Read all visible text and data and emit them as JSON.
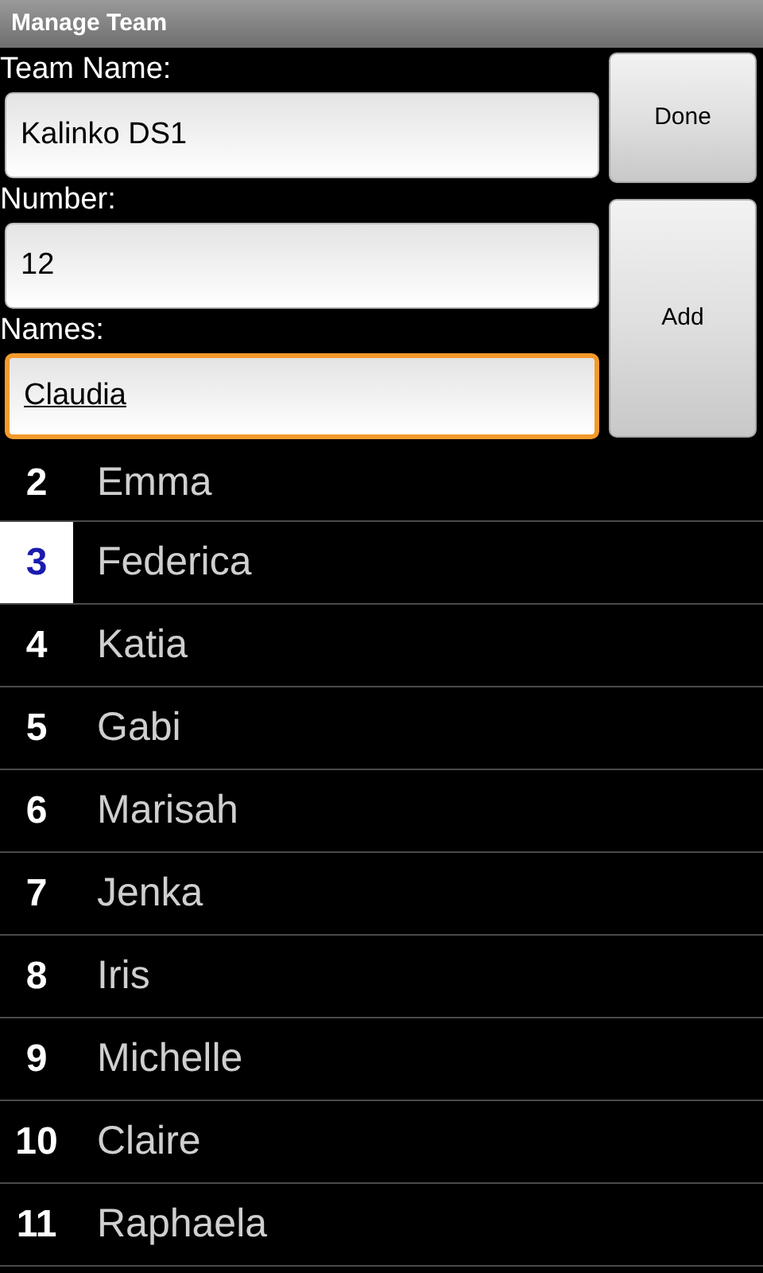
{
  "window": {
    "title": "Manage Team"
  },
  "fields": [
    {
      "label": "Team Name:",
      "value": "Kalinko DS1",
      "focused": false
    },
    {
      "label": "Number:",
      "value": "12",
      "focused": false
    },
    {
      "label": "Names:",
      "value": "Claudia",
      "focused": true
    }
  ],
  "buttons": [
    "Done",
    "Add"
  ],
  "players": [
    {
      "number": "2",
      "name": "Emma",
      "selected": false
    },
    {
      "number": "3",
      "name": "Federica",
      "selected": true
    },
    {
      "number": "4",
      "name": "Katia",
      "selected": false
    },
    {
      "number": "5",
      "name": "Gabi",
      "selected": false
    },
    {
      "number": "6",
      "name": "Marisah",
      "selected": false
    },
    {
      "number": "7",
      "name": "Jenka",
      "selected": false
    },
    {
      "number": "8",
      "name": "Iris",
      "selected": false
    },
    {
      "number": "9",
      "name": "Michelle",
      "selected": false
    },
    {
      "number": "10",
      "name": "Claire",
      "selected": false
    },
    {
      "number": "11",
      "name": "Raphaela",
      "selected": false
    }
  ]
}
